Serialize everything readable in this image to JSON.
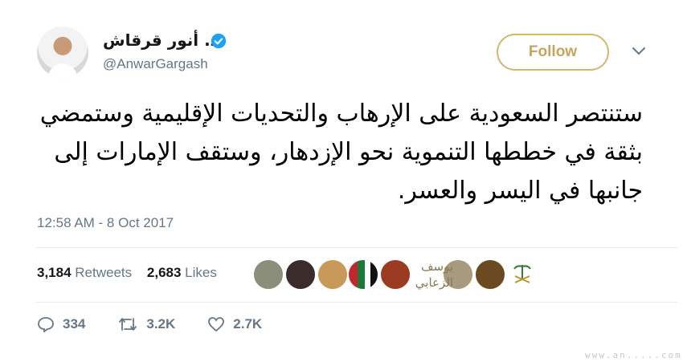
{
  "author": {
    "display_name": "د. أنور قرقاش",
    "handle": "@AnwarGargash",
    "verified": true
  },
  "follow_button": {
    "label": "Follow",
    "color": "#c9a45b"
  },
  "tweet": {
    "text": "ستنتصر السعودية على الإرهاب والتحديات الإقليمية وستمضي بثقة في خططها التنموية نحو الإزدهار، وستقف الإمارات إلى جانبها في اليسر والعسر.",
    "timestamp": "12:58 AM - 8 Oct 2017"
  },
  "stats": {
    "retweets_count": "3,184",
    "retweets_label": "Retweets",
    "likes_count": "2,683",
    "likes_label": "Likes"
  },
  "likers": {
    "name_text": "يوسف الزعابي"
  },
  "actions": {
    "reply_count": "334",
    "retweet_count": "3.2K",
    "like_count": "2.7K"
  },
  "icons": [
    "verified-badge-icon",
    "chevron-down-icon",
    "reply-icon",
    "retweet-icon",
    "heart-icon"
  ],
  "colors": {
    "verified": "#1da1f2",
    "follow_border": "#d4b775",
    "muted": "#657786"
  },
  "watermark": "www.an.....com"
}
